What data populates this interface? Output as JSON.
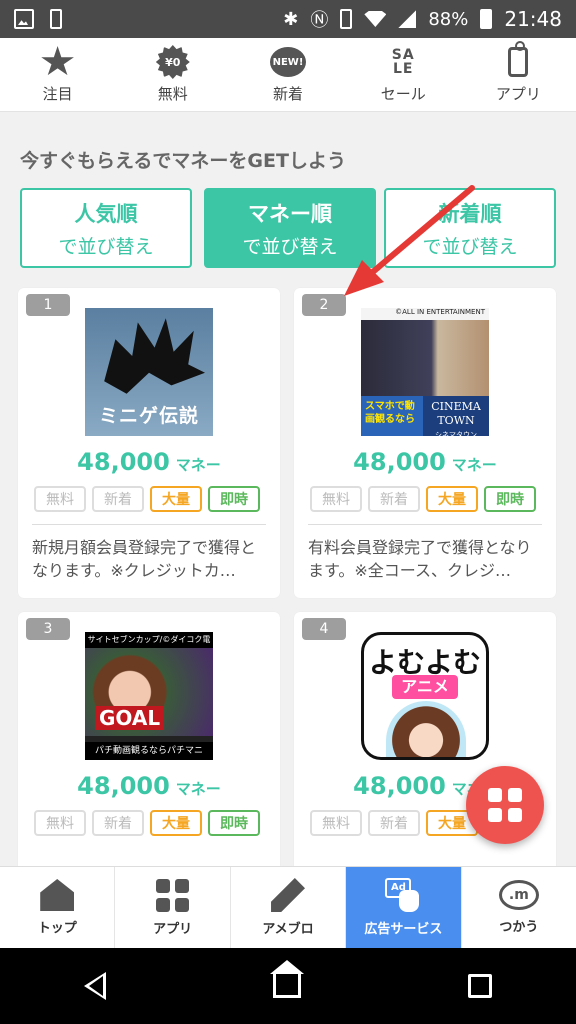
{
  "status_bar": {
    "battery": "88%",
    "time": "21:48",
    "icons": [
      "image-icon",
      "vibrate-icon",
      "bluetooth-icon",
      "nfc-icon",
      "vibrate-icon",
      "wifi-icon",
      "signal-icon",
      "battery-icon"
    ]
  },
  "top_nav": {
    "items": [
      {
        "label": "注目",
        "icon": "star-icon"
      },
      {
        "label": "無料",
        "icon": "free-burst-icon",
        "badge": "¥0"
      },
      {
        "label": "新着",
        "icon": "new-badge-icon",
        "badge": "NEW!"
      },
      {
        "label": "セール",
        "icon": "sale-icon",
        "badge": "SALE"
      },
      {
        "label": "アプリ",
        "icon": "phone-icon"
      }
    ]
  },
  "heading": "今すぐもらえるでマネーをGETしよう",
  "sort_buttons": [
    {
      "line1": "人気順",
      "line2": "で並び替え",
      "active": false
    },
    {
      "line1": "マネー順",
      "line2": "で並び替え",
      "active": true
    },
    {
      "line1": "新着順",
      "line2": "で並び替え",
      "active": false
    }
  ],
  "offers": [
    {
      "rank": "1",
      "thumb_text": "ミニゲ伝説",
      "price": "48,000",
      "unit": "マネー",
      "tags": [
        "無料",
        "新着",
        "大量",
        "即時"
      ],
      "desc": "新規月額会員登録完了で獲得となります。※クレジットカ…"
    },
    {
      "rank": "2",
      "thumb_top": "©ALL IN ENTERTAINMENT",
      "thumb_text": "スマホで動画観るなら",
      "thumb_brand": "CINEMA TOWN",
      "thumb_brand_sub": "シネマタウン",
      "price": "48,000",
      "unit": "マネー",
      "tags": [
        "無料",
        "新着",
        "大量",
        "即時"
      ],
      "desc": "有料会員登録完了で獲得となります。※全コース、クレジ…"
    },
    {
      "rank": "3",
      "thumb_header": "サイトセブンカップ/©ダイコク電機",
      "thumb_text": "GOAL",
      "thumb_footer": "パチ動画観るならパチマニ",
      "price": "48,000",
      "unit": "マネー",
      "tags": [
        "無料",
        "新着",
        "大量",
        "即時"
      ]
    },
    {
      "rank": "4",
      "thumb_text": "よむよむ",
      "thumb_sub": "アニメ",
      "price": "48,000",
      "unit": "マネー",
      "tags": [
        "無料",
        "新着",
        "大量"
      ]
    }
  ],
  "bottom_nav": {
    "items": [
      {
        "label": "トップ",
        "icon": "home-icon",
        "active": false
      },
      {
        "label": "アプリ",
        "icon": "apps-grid-icon",
        "active": false
      },
      {
        "label": "アメブロ",
        "icon": "pen-icon",
        "active": false
      },
      {
        "label": "広告サービス",
        "icon": "ad-tap-icon",
        "badge": "Ad",
        "active": true
      },
      {
        "label": "つかう",
        "icon": "money-coin-icon",
        "badge": ".m",
        "active": false
      }
    ]
  },
  "colors": {
    "accent": "#3cc6a6",
    "status_bar": "#4a4a4a",
    "fab": "#ef5350",
    "active_tab": "#4a8ff0",
    "arrow": "#e53935",
    "tag_orange": "#f5a623",
    "tag_green": "#5cb85c"
  }
}
